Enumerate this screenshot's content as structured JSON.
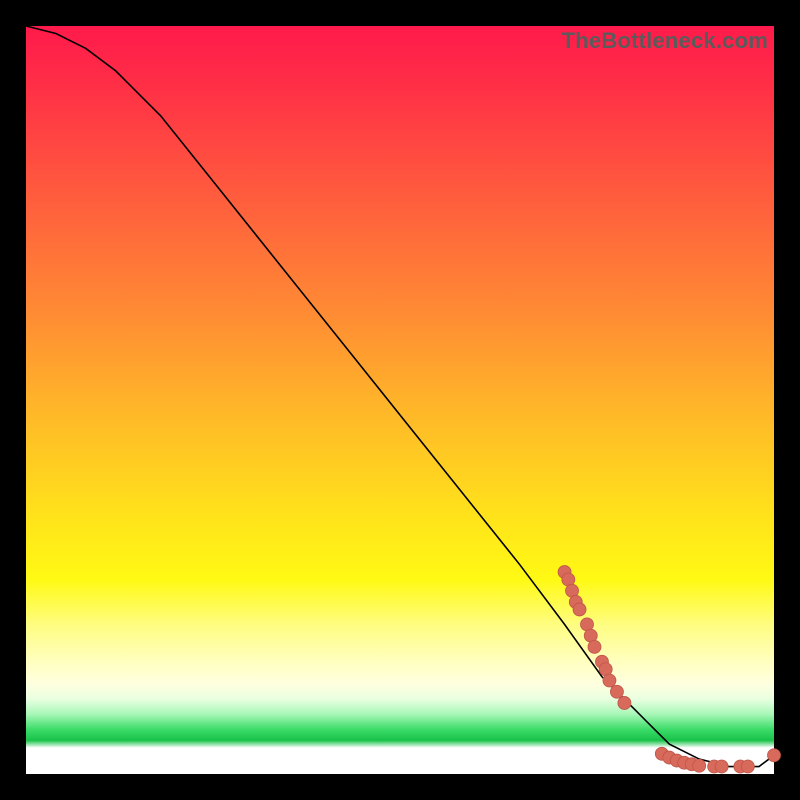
{
  "watermark": "TheBottleneck.com",
  "colors": {
    "background": "#000000",
    "marker_fill": "#d86a5c",
    "marker_stroke": "#bf5547",
    "curve": "#000000"
  },
  "chart_data": {
    "type": "line",
    "title": "",
    "xlabel": "",
    "ylabel": "",
    "xlim": [
      0,
      100
    ],
    "ylim": [
      0,
      100
    ],
    "series": [
      {
        "name": "curve",
        "x": [
          0,
          4,
          8,
          12,
          18,
          26,
          34,
          42,
          50,
          58,
          66,
          72,
          77,
          80,
          83,
          86,
          90,
          94,
          98,
          100
        ],
        "y": [
          100,
          99,
          97,
          94,
          88,
          78,
          68,
          58,
          48,
          38,
          28,
          20,
          13,
          10,
          7,
          4,
          2,
          1,
          1,
          2.5
        ]
      }
    ],
    "markers": [
      {
        "x": 72,
        "y": 27
      },
      {
        "x": 72.5,
        "y": 26
      },
      {
        "x": 73,
        "y": 24.5
      },
      {
        "x": 73.5,
        "y": 23
      },
      {
        "x": 74,
        "y": 22
      },
      {
        "x": 75,
        "y": 20
      },
      {
        "x": 75.5,
        "y": 18.5
      },
      {
        "x": 76,
        "y": 17
      },
      {
        "x": 77,
        "y": 15
      },
      {
        "x": 77.5,
        "y": 14
      },
      {
        "x": 78,
        "y": 12.5
      },
      {
        "x": 79,
        "y": 11
      },
      {
        "x": 80,
        "y": 9.5
      },
      {
        "x": 85,
        "y": 2.7
      },
      {
        "x": 86,
        "y": 2.2
      },
      {
        "x": 87,
        "y": 1.8
      },
      {
        "x": 88,
        "y": 1.5
      },
      {
        "x": 89,
        "y": 1.3
      },
      {
        "x": 90,
        "y": 1.1
      },
      {
        "x": 92,
        "y": 1.0
      },
      {
        "x": 93,
        "y": 1.0
      },
      {
        "x": 95.5,
        "y": 1.0
      },
      {
        "x": 96.5,
        "y": 1.0
      },
      {
        "x": 100,
        "y": 2.5
      }
    ]
  }
}
